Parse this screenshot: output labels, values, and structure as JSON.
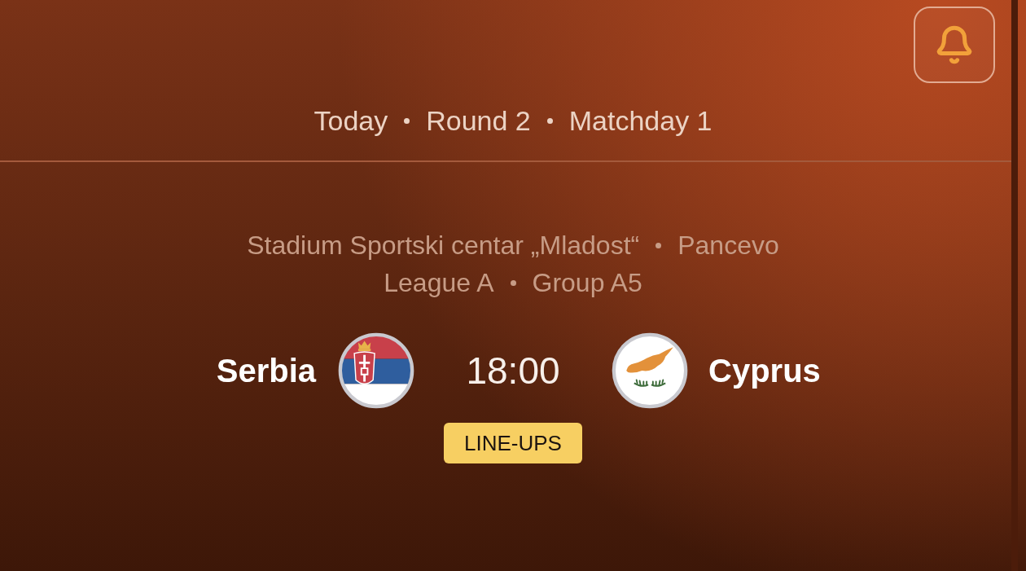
{
  "match_info": [
    "Today",
    "Round 2",
    "Matchday 1"
  ],
  "venue": [
    "Stadium Sportski centar „Mladost“",
    "Pancevo"
  ],
  "competition": [
    "League A",
    "Group A5"
  ],
  "home_team": {
    "name": "Serbia"
  },
  "kickoff_time": "18:00",
  "away_team": {
    "name": "Cyprus"
  },
  "lineups_button": "LINE-UPS"
}
